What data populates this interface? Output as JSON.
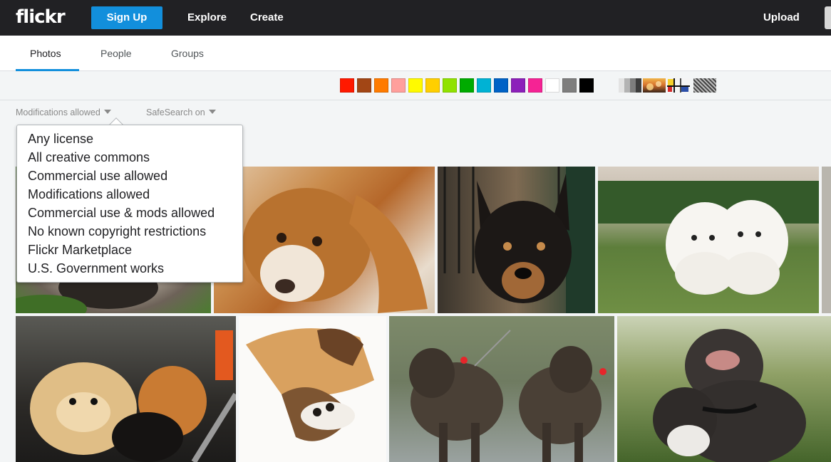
{
  "nav": {
    "logo": "flickr",
    "signup": "Sign Up",
    "explore": "Explore",
    "create": "Create",
    "upload": "Upload"
  },
  "tabs": [
    {
      "label": "Photos",
      "active": true
    },
    {
      "label": "People",
      "active": false
    },
    {
      "label": "Groups",
      "active": false
    }
  ],
  "color_filters": [
    "#ff1900",
    "#a24615",
    "#ff7b00",
    "#ff9f9c",
    "#fffa00",
    "#ffcf00",
    "#90e200",
    "#00ab00",
    "#00b2d4",
    "#0062c6",
    "#8c20ba",
    "#f52394",
    "#ffffff",
    "#7e7e7e",
    "#000000"
  ],
  "style_filters": [
    "black-and-white-icon",
    "shallow-depth-of-field-icon",
    "minimalist-icon",
    "patterns-icon"
  ],
  "filters": {
    "license": "Modifications allowed",
    "safesearch": "SafeSearch on"
  },
  "license_menu": [
    "Any license",
    "All creative commons",
    "Commercial use allowed",
    "Modifications allowed",
    "Commercial use & mods allowed",
    "No known copyright restrictions",
    "Flickr Marketplace",
    "U.S. Government works"
  ],
  "photos": [
    "pug-photo",
    "cocker-spaniel-photo",
    "black-tan-dog-photo",
    "two-bichon-photo",
    "pomeranians-photo",
    "sleeping-dog-photo",
    "two-brindle-dogs-photo",
    "bulldogs-photo"
  ],
  "colors": {
    "brand_blue": "#128fdc",
    "nav_bg": "#212124"
  }
}
